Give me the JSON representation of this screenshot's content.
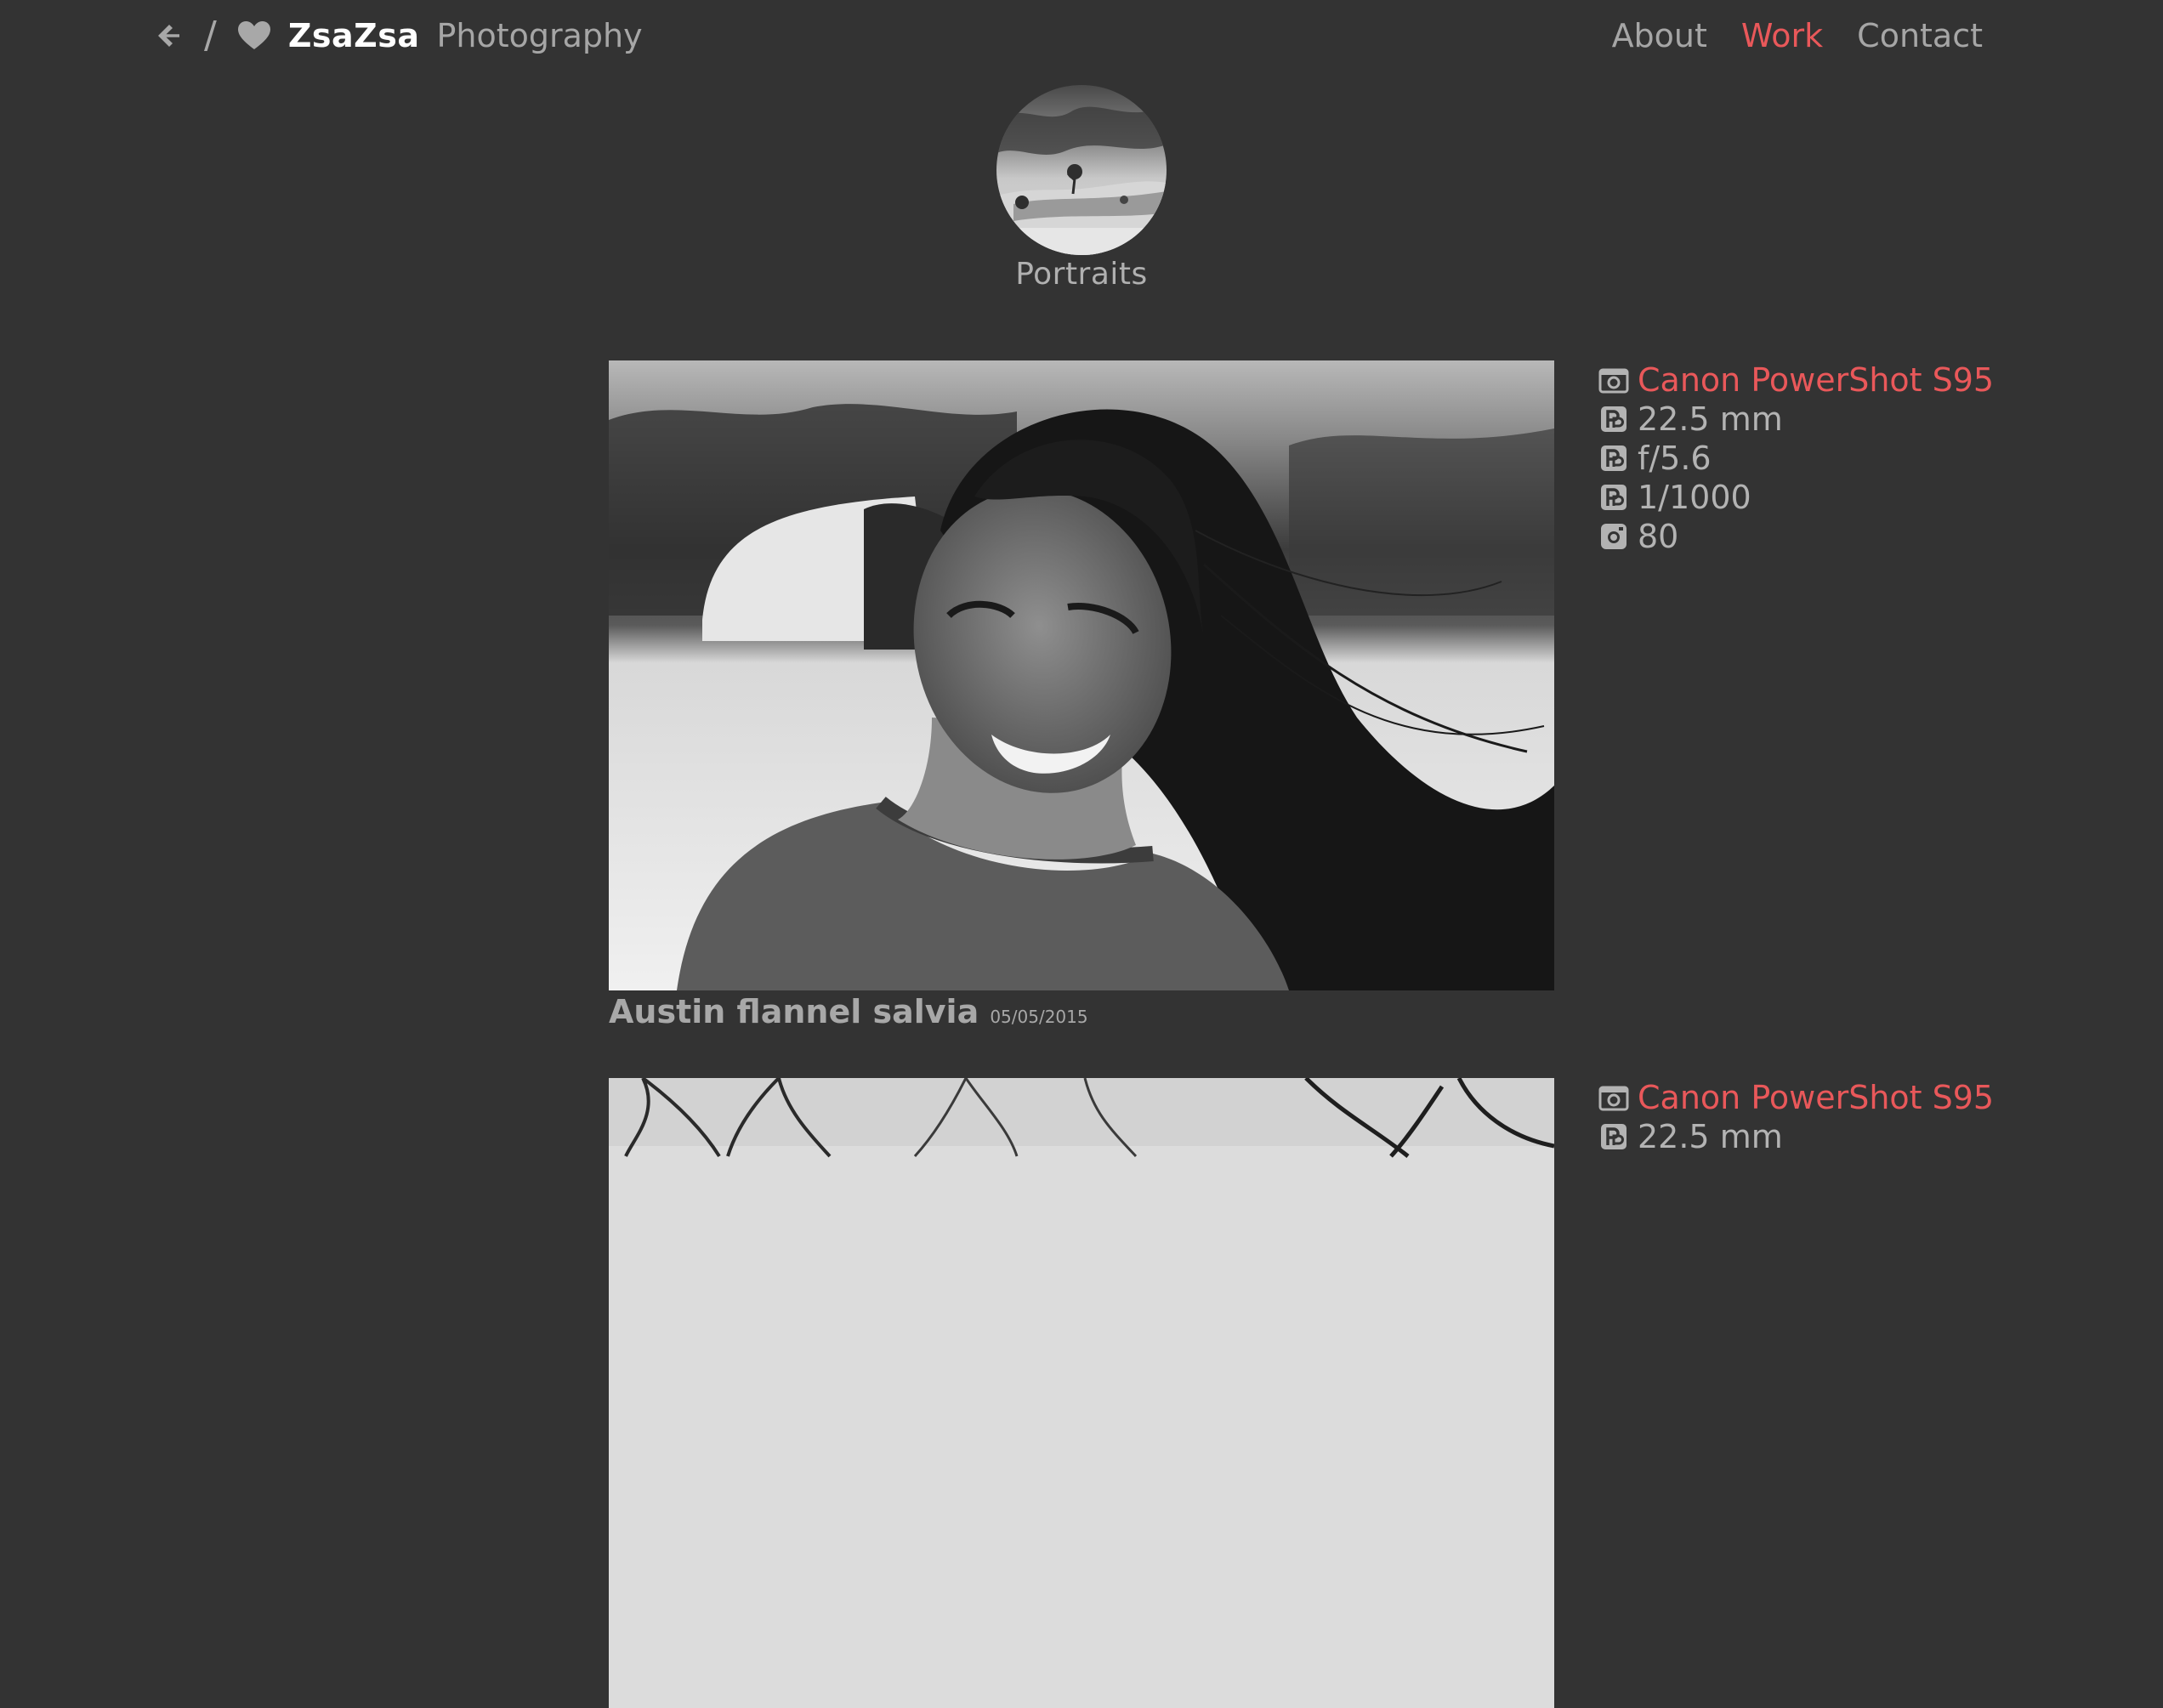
{
  "header": {
    "breadcrumb_separator": "/",
    "site_name": "ZsaZsa",
    "site_subtitle": "Photography",
    "nav": [
      {
        "label": "About",
        "active": false
      },
      {
        "label": "Work",
        "active": true
      },
      {
        "label": "Contact",
        "active": false
      }
    ]
  },
  "album": {
    "title": "Portraits",
    "thumbnail_icon": "landscape-thumbnail"
  },
  "posts": [
    {
      "title": "Austin flannel salvia",
      "date": "05/05/2015",
      "exif": {
        "camera": "Canon PowerShot S95",
        "focal_length": "22.5 mm",
        "aperture": "f/5.6",
        "shutter": "1/1000",
        "iso": "80"
      }
    },
    {
      "exif": {
        "camera": "Canon PowerShot S95",
        "focal_length": "22.5 mm"
      }
    }
  ],
  "colors": {
    "background": "#333333",
    "accent": "#e9585a",
    "text_muted": "#a6a6a6",
    "text_bright": "#ffffff"
  }
}
